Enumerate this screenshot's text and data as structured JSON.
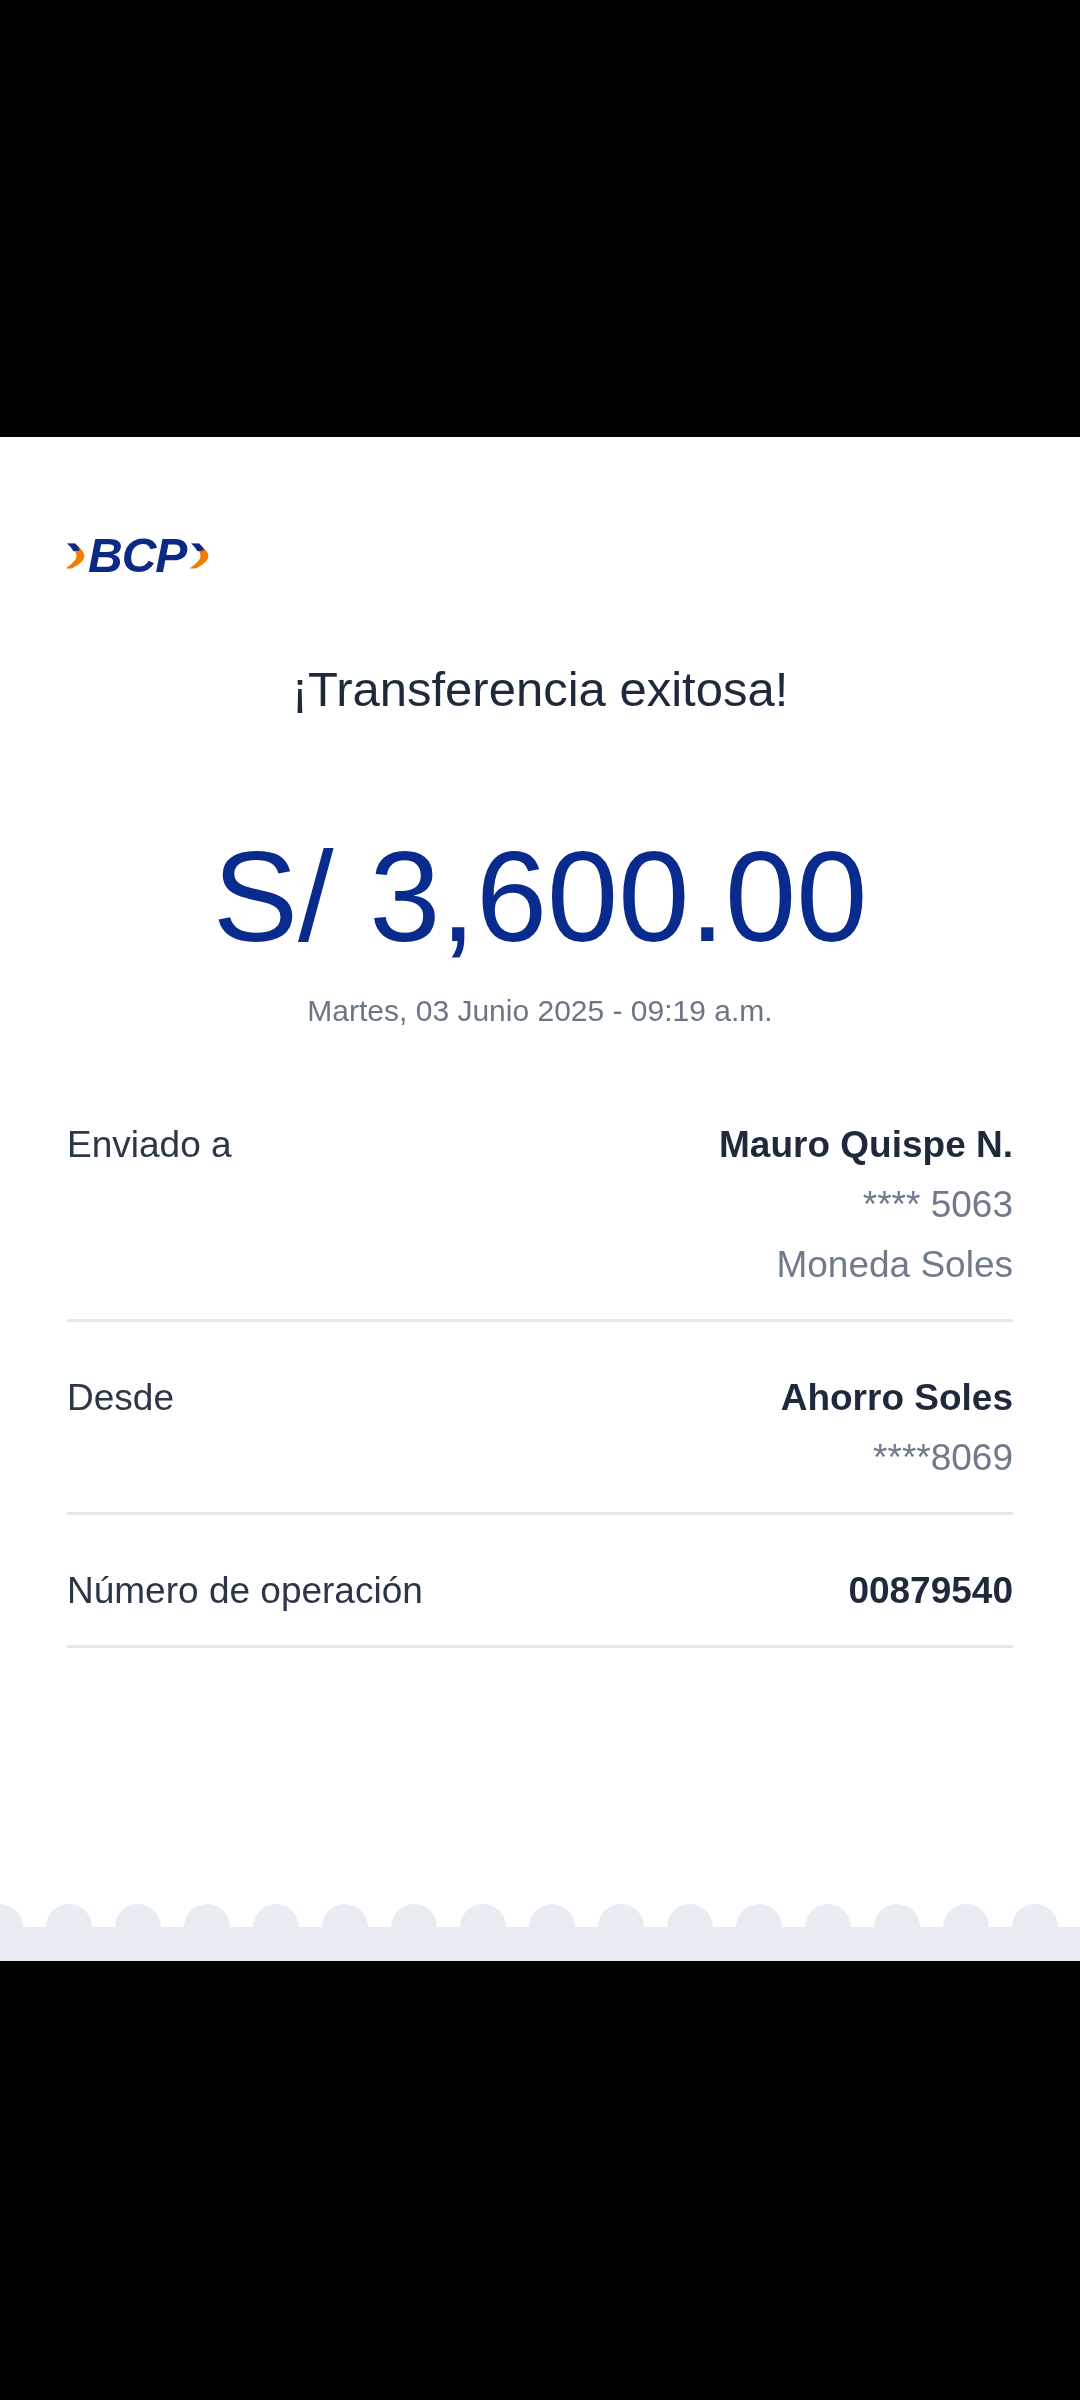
{
  "logo": {
    "text": "BCP"
  },
  "title": "¡Transferencia exitosa!",
  "amount": "S/ 3,600.00",
  "datetime": "Martes, 03 Junio 2025 - 09:19 a.m.",
  "details": [
    {
      "label": "Enviado a",
      "lines": [
        {
          "kind": "strong",
          "text": "Mauro Quispe N."
        },
        {
          "kind": "muted",
          "text": "**** 5063"
        },
        {
          "kind": "muted",
          "text": "Moneda Soles"
        }
      ]
    },
    {
      "label": "Desde",
      "lines": [
        {
          "kind": "strong",
          "text": "Ahorro Soles"
        },
        {
          "kind": "muted",
          "text": "****8069"
        }
      ]
    },
    {
      "label": "Número de operación",
      "lines": [
        {
          "kind": "strong",
          "text": "00879540"
        }
      ]
    }
  ]
}
